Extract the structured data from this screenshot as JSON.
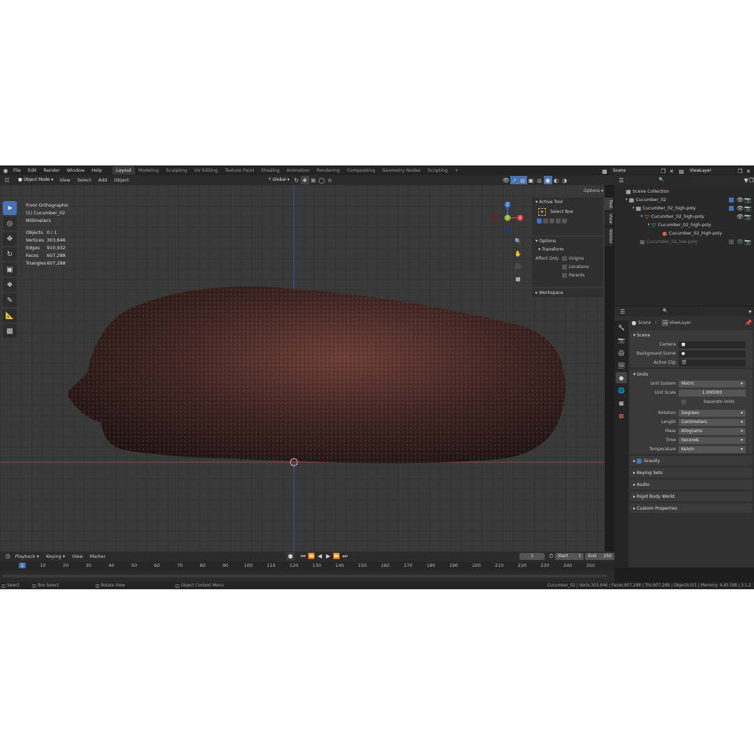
{
  "menubar": {
    "menus": [
      "File",
      "Edit",
      "Render",
      "Window",
      "Help"
    ],
    "workspaces": [
      "Layout",
      "Modeling",
      "Sculpting",
      "UV Editing",
      "Texture Paint",
      "Shading",
      "Animation",
      "Rendering",
      "Compositing",
      "Geometry Nodes",
      "Scripting"
    ],
    "active_workspace": "Layout",
    "scene": "Scene",
    "view_layer": "ViewLayer"
  },
  "viewport_header": {
    "mode": "Object Mode",
    "menus": [
      "View",
      "Select",
      "Add",
      "Object"
    ],
    "orientation": "Global",
    "options": "Options"
  },
  "viewport": {
    "view_name": "Front Orthographic",
    "object_label": "(1) Cucumber_02",
    "units": "Millimeters",
    "stats": [
      {
        "key": "Objects",
        "value": "0 / 1"
      },
      {
        "key": "Vertices",
        "value": "303,646"
      },
      {
        "key": "Edges",
        "value": "910,932"
      },
      {
        "key": "Faces",
        "value": "607,288"
      },
      {
        "key": "Triangles",
        "value": "607,288"
      }
    ],
    "gizmo": {
      "z": "Z",
      "y": "Y",
      "x": "X"
    }
  },
  "npanel": {
    "active_tool": "Active Tool",
    "select_box": "Select Box",
    "options": "Options",
    "transform": "Transform",
    "affect_only": "Affect Only",
    "origins": "Origins",
    "locations": "Locations",
    "parents": "Parents",
    "workspace": "Workspace",
    "tabs": [
      "Tool",
      "View",
      "Welder"
    ]
  },
  "outliner": {
    "items": [
      {
        "label": "Scene Collection",
        "depth": 0
      },
      {
        "label": "Cucumber_02",
        "depth": 1
      },
      {
        "label": "Cucumber_02_high-poly",
        "depth": 2
      },
      {
        "label": "Cucumber_02_high-poly",
        "depth": 3
      },
      {
        "label": "Cucumber_02_high-poly",
        "depth": 4
      },
      {
        "label": "Cucumber_02_high-poly",
        "depth": 5
      },
      {
        "label": "Cucumber_02_low-poly",
        "depth": 2
      }
    ]
  },
  "properties": {
    "breadcrumb_scene": "Scene",
    "breadcrumb_layer": "ViewLayer",
    "scene_panel": "Scene",
    "camera": "Camera",
    "background_scene": "Background Scene",
    "active_clip": "Active Clip",
    "units_panel": "Units",
    "unit_rows": [
      {
        "label": "Unit System",
        "value": "Metric"
      },
      {
        "label": "Unit Scale",
        "value": "1.000000"
      }
    ],
    "separate_units": "Separate Units",
    "unit_rows2": [
      {
        "label": "Rotation",
        "value": "Degrees"
      },
      {
        "label": "Length",
        "value": "Centimeters"
      },
      {
        "label": "Mass",
        "value": "Kilograms"
      },
      {
        "label": "Time",
        "value": "Seconds"
      },
      {
        "label": "Temperature",
        "value": "Kelvin"
      }
    ],
    "collapsed": [
      "Gravity",
      "Keying Sets",
      "Audio",
      "Rigid Body World",
      "Custom Properties"
    ]
  },
  "timeline": {
    "menus": [
      "Playback",
      "Keying",
      "View",
      "Marker"
    ],
    "current_frame": "1",
    "start_label": "Start",
    "start": "1",
    "end_label": "End",
    "end": "250",
    "ticks": [
      "1",
      "10",
      "20",
      "30",
      "40",
      "50",
      "60",
      "70",
      "80",
      "90",
      "100",
      "110",
      "120",
      "130",
      "140",
      "150",
      "160",
      "170",
      "180",
      "190",
      "200",
      "210",
      "220",
      "230",
      "240",
      "250"
    ]
  },
  "statusbar": {
    "select": "Select",
    "box_select": "Box Select",
    "rotate_view": "Rotate View",
    "context_menu": "Object Context Menu",
    "info": "Cucumber_02 | Verts:303,646 | Faces:607,288 | Tris:607,288 | Objects:0/1 | Memory: 4.45 GiB | 3.1.2"
  },
  "colors": {
    "accent": "#4772b3",
    "x_axis": "#d43c4c",
    "y_axis": "#7aa12a",
    "z_axis": "#3f6fcf"
  }
}
